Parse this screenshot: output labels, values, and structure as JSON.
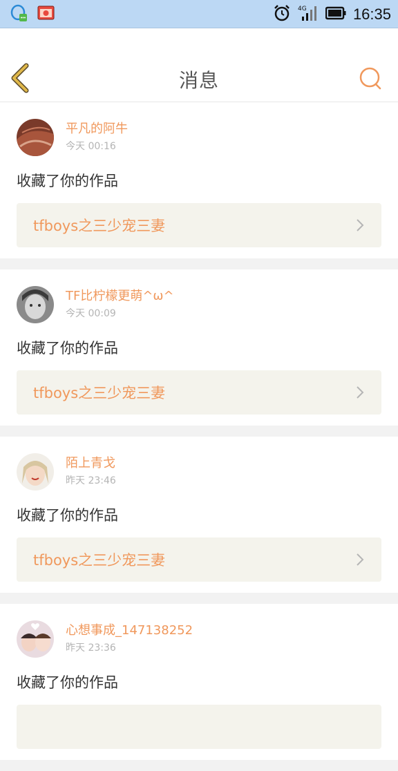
{
  "status_bar": {
    "time": "16:35",
    "network": "4G"
  },
  "header": {
    "title": "消息"
  },
  "messages": [
    {
      "username": "平凡的阿牛",
      "time": "今天 00:16",
      "action": "收藏了你的作品",
      "work_title": "tfboys之三少宠三妻"
    },
    {
      "username": "TF比柠檬更萌^ω^",
      "time": "今天 00:09",
      "action": "收藏了你的作品",
      "work_title": "tfboys之三少宠三妻"
    },
    {
      "username": "陌上青戈",
      "time": "昨天 23:46",
      "action": "收藏了你的作品",
      "work_title": "tfboys之三少宠三妻"
    },
    {
      "username": "心想事成_147138252",
      "time": "昨天 23:36",
      "action": "收藏了你的作品",
      "work_title": ""
    }
  ],
  "colors": {
    "accent": "#f0985c",
    "back_arrow": "#e0b84a",
    "status_bar_bg": "#bcd8f4"
  }
}
